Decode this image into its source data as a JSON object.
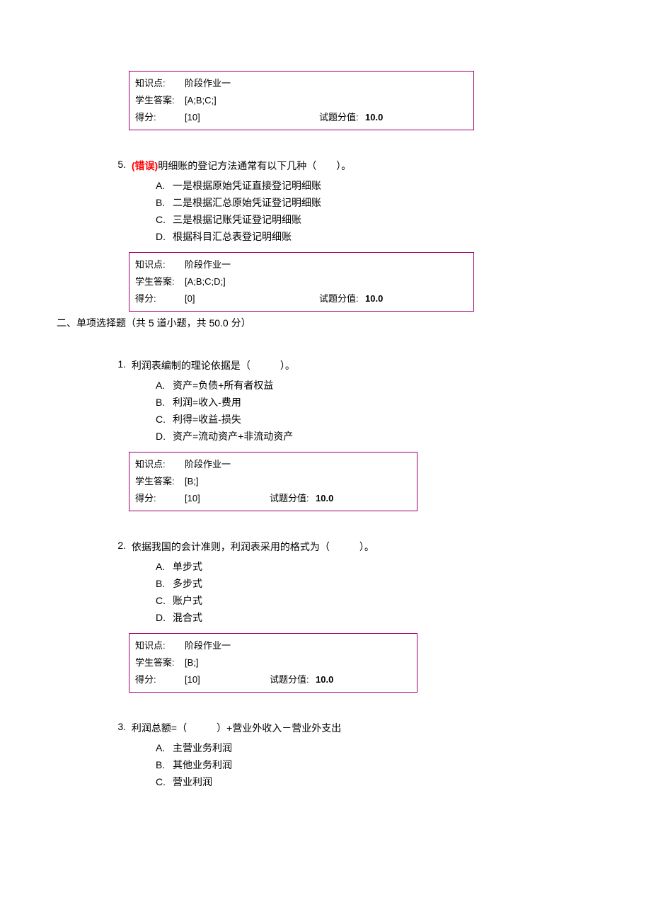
{
  "labels": {
    "knowledge_point": "知识点:",
    "student_answer": "学生答案:",
    "score": "得分:",
    "question_value": "试题分值:"
  },
  "box_top": {
    "knowledge_point_value": "阶段作业一",
    "student_answer_value": "[A;B;C;]",
    "score_value": "[10]",
    "question_value_value": "10.0"
  },
  "q5": {
    "number": "5.",
    "tag": "(错误)",
    "text": "明细账的登记方法通常有以下几种（　　）。",
    "options": {
      "A": "一是根据原始凭证直接登记明细账",
      "B": "二是根据汇总原始凭证登记明细账",
      "C": "三是根据记账凭证登记明细账",
      "D": "根据科目汇总表登记明细账"
    },
    "box": {
      "knowledge_point_value": "阶段作业一",
      "student_answer_value": "[A;B;C;D;]",
      "score_value": "[0]",
      "question_value_value": "10.0"
    }
  },
  "section2": "二、单项选择题（共 5 道小题，共 50.0 分）",
  "s2q1": {
    "number": "1.",
    "text": "利润表编制的理论依据是（　　　）。",
    "options": {
      "A": "资产=负债+所有者权益",
      "B": "利润=收入-费用",
      "C": "利得=收益-损失",
      "D": "资产=流动资产+非流动资产"
    },
    "box": {
      "knowledge_point_value": "阶段作业一",
      "student_answer_value": "[B;]",
      "score_value": "[10]",
      "question_value_value": "10.0"
    }
  },
  "s2q2": {
    "number": "2.",
    "text": "依据我国的会计准则，利润表采用的格式为（　　　）。",
    "options": {
      "A": "单步式",
      "B": "多步式",
      "C": "账户式",
      "D": "混合式"
    },
    "box": {
      "knowledge_point_value": "阶段作业一",
      "student_answer_value": "[B;]",
      "score_value": "[10]",
      "question_value_value": "10.0"
    }
  },
  "s2q3": {
    "number": "3.",
    "text": "利润总额=（　　　）+营业外收入－营业外支出",
    "options": {
      "A": "主营业务利润",
      "B": "其他业务利润",
      "C": "营业利润"
    }
  }
}
